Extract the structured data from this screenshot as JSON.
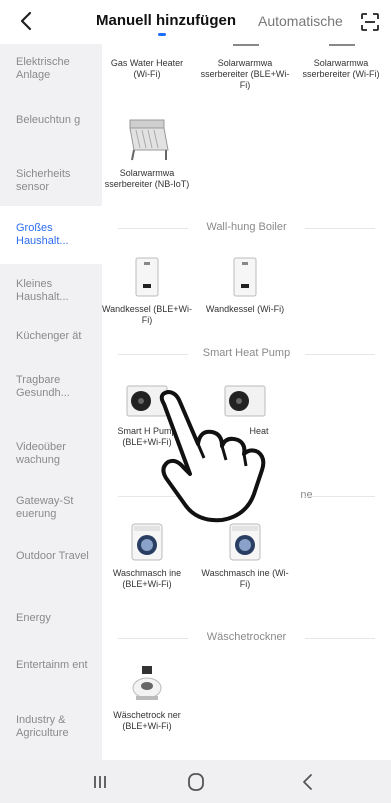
{
  "header": {
    "tab_manual": "Manuell hinzufügen",
    "tab_auto": "Automatische",
    "accent": "#1f6fff"
  },
  "sidebar": {
    "items": [
      {
        "label": "Elektrische Anlage"
      },
      {
        "label": "Beleuchtun g"
      },
      {
        "label": "Sicherheits sensor"
      },
      {
        "label": "Großes Haushalt..."
      },
      {
        "label": "Kleines Haushalt..."
      },
      {
        "label": "Küchenger ät"
      },
      {
        "label": "Tragbare Gesundh..."
      },
      {
        "label": "Videoüber wachung"
      },
      {
        "label": "Gateway-St euerung"
      },
      {
        "label": "Outdoor Travel"
      },
      {
        "label": "Energy"
      },
      {
        "label": "Entertainm ent"
      },
      {
        "label": "Industry & Agriculture"
      }
    ],
    "active_index": 3,
    "active_color": "#2d6ef0"
  },
  "devices_top": [
    {
      "name": "Gas Water Heater (Wi-Fi)"
    },
    {
      "name": "Solarwarmwa sserbereiter (BLE+Wi-Fi)"
    },
    {
      "name": "Solarwarmwa sserbereiter (Wi-Fi)"
    },
    {
      "name": "Solarwarmwa sserbereiter (NB-IoT)"
    }
  ],
  "sections": {
    "boiler": "Wall-hung Boiler",
    "heatpump": "Smart Heat Pump",
    "washer": "ne",
    "dryer": "Wäschetrockner"
  },
  "boilers": [
    {
      "name": "Wandkessel (BLE+Wi-Fi)"
    },
    {
      "name": "Wandkessel (Wi-Fi)"
    }
  ],
  "heatpumps": [
    {
      "name": "Smart H Pump (BLE+Wi-Fi)"
    },
    {
      "name": "Heat"
    }
  ],
  "washers": [
    {
      "name": "Waschmasch ine (BLE+Wi-Fi)"
    },
    {
      "name": "Waschmasch ine (Wi-Fi)"
    }
  ],
  "dryers": [
    {
      "name": "Wäschetrock ner (BLE+Wi-Fi)"
    }
  ],
  "navbar": {
    "icons": [
      "recent-apps-icon",
      "home-icon",
      "back-icon"
    ]
  }
}
